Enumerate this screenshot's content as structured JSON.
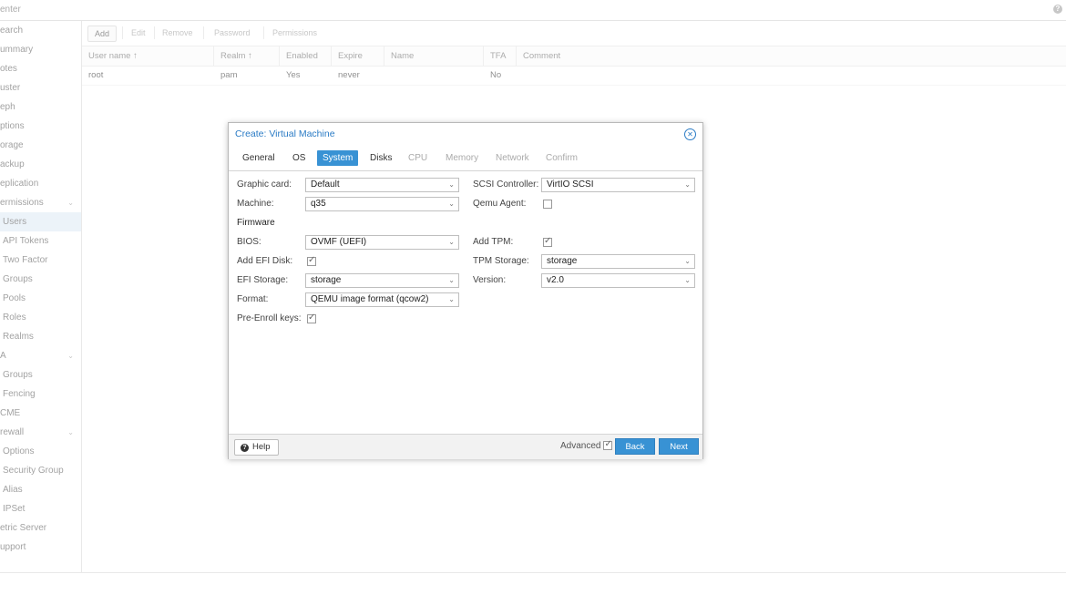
{
  "app": {
    "title": "enter"
  },
  "sidebar": {
    "items": [
      {
        "label": "earch"
      },
      {
        "label": "ummary"
      },
      {
        "label": "otes"
      },
      {
        "label": "uster"
      },
      {
        "label": "eph"
      },
      {
        "label": "ptions"
      },
      {
        "label": "orage"
      },
      {
        "label": "ackup"
      },
      {
        "label": "eplication"
      },
      {
        "label": "ermissions"
      },
      {
        "label": "Users"
      },
      {
        "label": "API Tokens"
      },
      {
        "label": "Two Factor"
      },
      {
        "label": "Groups"
      },
      {
        "label": "Pools"
      },
      {
        "label": "Roles"
      },
      {
        "label": "Realms"
      },
      {
        "label": "A"
      },
      {
        "label": "Groups"
      },
      {
        "label": "Fencing"
      },
      {
        "label": "CME"
      },
      {
        "label": "rewall"
      },
      {
        "label": "Options"
      },
      {
        "label": "Security Group"
      },
      {
        "label": "Alias"
      },
      {
        "label": "IPSet"
      },
      {
        "label": "etric Server"
      },
      {
        "label": "upport"
      }
    ]
  },
  "toolbar": {
    "add": "Add",
    "edit": "Edit",
    "remove": "Remove",
    "password": "Password",
    "permissions": "Permissions"
  },
  "users_grid": {
    "columns": [
      "User name ↑",
      "Realm ↑",
      "Enabled",
      "Expire",
      "Name",
      "TFA",
      "Comment"
    ],
    "rows": [
      {
        "user": "root",
        "realm": "pam",
        "enabled": "Yes",
        "expire": "never",
        "name": "",
        "tfa": "No",
        "comment": ""
      }
    ]
  },
  "dialog": {
    "title": "Create: Virtual Machine",
    "tabs": [
      "General",
      "OS",
      "System",
      "Disks",
      "CPU",
      "Memory",
      "Network",
      "Confirm"
    ],
    "active_tab": "System",
    "left": {
      "graphic_card_label": "Graphic card:",
      "graphic_card": "Default",
      "machine_label": "Machine:",
      "machine": "q35",
      "firmware_heading": "Firmware",
      "bios_label": "BIOS:",
      "bios": "OVMF (UEFI)",
      "add_efi_label": "Add EFI Disk:",
      "efi_storage_label": "EFI Storage:",
      "efi_storage": "storage",
      "format_label": "Format:",
      "format": "QEMU image format (qcow2)",
      "preenroll_label": "Pre-Enroll keys:"
    },
    "right": {
      "scsi_label": "SCSI Controller:",
      "scsi": "VirtIO SCSI",
      "qemu_agent_label": "Qemu Agent:",
      "add_tpm_label": "Add TPM:",
      "tpm_storage_label": "TPM Storage:",
      "tpm_storage": "storage",
      "version_label": "Version:",
      "version": "v2.0"
    },
    "checks": {
      "add_efi": true,
      "preenroll": true,
      "qemu_agent": false,
      "add_tpm": true,
      "advanced": true
    },
    "footer": {
      "help": "Help",
      "advanced": "Advanced",
      "back": "Back",
      "next": "Next"
    }
  },
  "colors": {
    "accent": "#3892d4",
    "title": "#2a7bc5"
  }
}
